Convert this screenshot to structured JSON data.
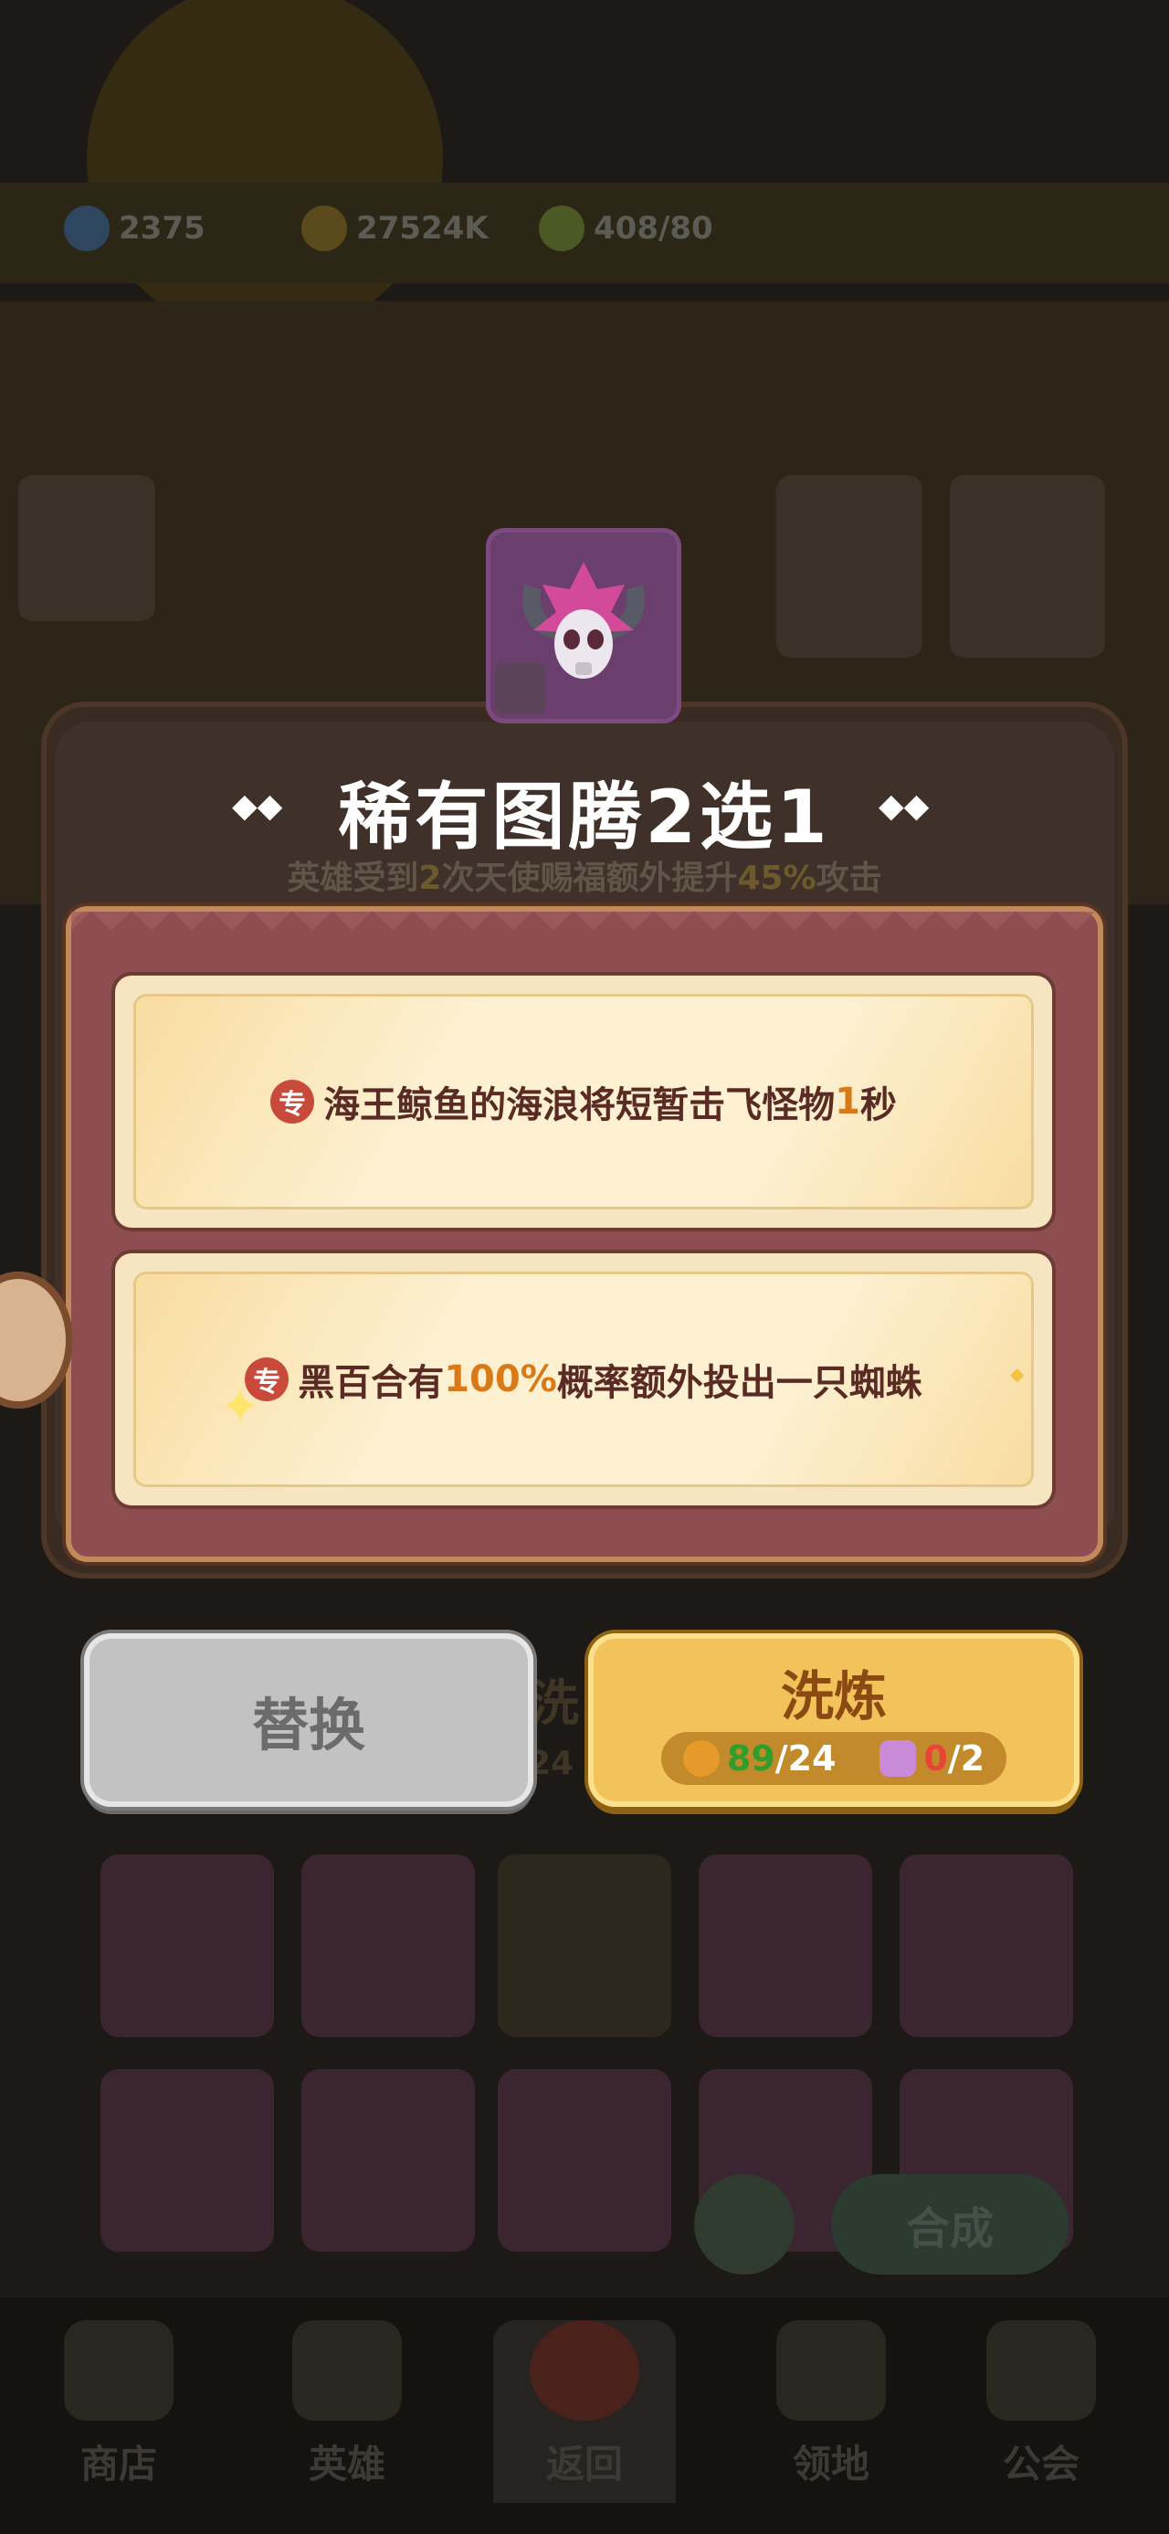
{
  "background": {
    "resources": [
      "2375",
      "27524K",
      "408/80"
    ],
    "merge_button_label": "合成",
    "nav": [
      "商店",
      "英雄",
      "返回",
      "领地",
      "公会"
    ]
  },
  "dialog": {
    "title": "稀有图腾2选1",
    "subtitle_parts": [
      "英雄受到",
      "2",
      "次天使赐福额外提升",
      "45%",
      "攻击"
    ],
    "options": [
      {
        "badge": "专",
        "text_before": "海王鲸鱼的海浪将短暂击飞怪物",
        "highlight": "1",
        "text_after": "秒"
      },
      {
        "badge": "专",
        "text_before": "黑百合有",
        "highlight": "100%",
        "text_after": "概率额外投出一只蜘蛛"
      }
    ]
  },
  "buttons": {
    "replace_label": "替换",
    "refine_label": "洗炼",
    "cost1_have": "89",
    "cost1_need": "/24",
    "cost2_have": "0",
    "cost2_need": "/2"
  },
  "ghost": {
    "partial_refine": "洗",
    "partial_number": "24"
  },
  "colors": {
    "panel": "#8e4d50",
    "option_bg": "#f6e5c0",
    "highlight": "#d97a18",
    "refine_button": "#f2c35a",
    "replace_button": "#c2c2c2"
  }
}
